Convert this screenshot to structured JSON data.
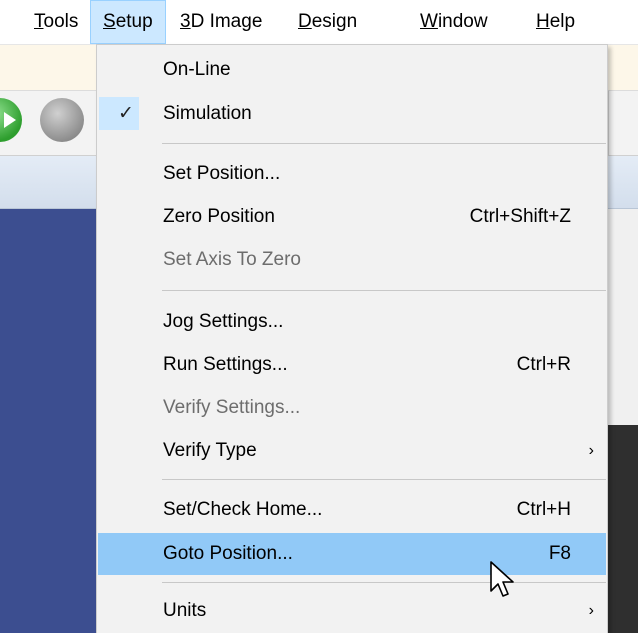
{
  "menubar": [
    {
      "pre": "",
      "mn": "T",
      "post": "ools"
    },
    {
      "pre": "",
      "mn": "S",
      "post": "etup"
    },
    {
      "pre": "",
      "mn": "3",
      "post": "D Image"
    },
    {
      "pre": "",
      "mn": "D",
      "post": "esign"
    },
    {
      "pre": "",
      "mn": "W",
      "post": "indow"
    },
    {
      "pre": "",
      "mn": "H",
      "post": "elp"
    }
  ],
  "setup_menu": {
    "online": "On-Line",
    "simulation": "Simulation",
    "simulation_check": "✓",
    "set_position": "Set Position...",
    "zero_position": "Zero Position",
    "zero_position_shortcut": "Ctrl+Shift+Z",
    "set_axis_to_zero": "Set Axis To Zero",
    "jog_settings": "Jog Settings...",
    "run_settings": "Run Settings...",
    "run_settings_shortcut": "Ctrl+R",
    "verify_settings": "Verify Settings...",
    "verify_type": "Verify Type",
    "submenu_arrow": "›",
    "set_check_home": "Set/Check Home...",
    "set_check_home_shortcut": "Ctrl+H",
    "goto_position": "Goto Position...",
    "goto_position_shortcut": "F8",
    "units": "Units"
  },
  "colors": {
    "menu_highlight": "#91c9f7",
    "menubar_active": "#cce8ff",
    "workspace_blue": "#3c4e90"
  }
}
